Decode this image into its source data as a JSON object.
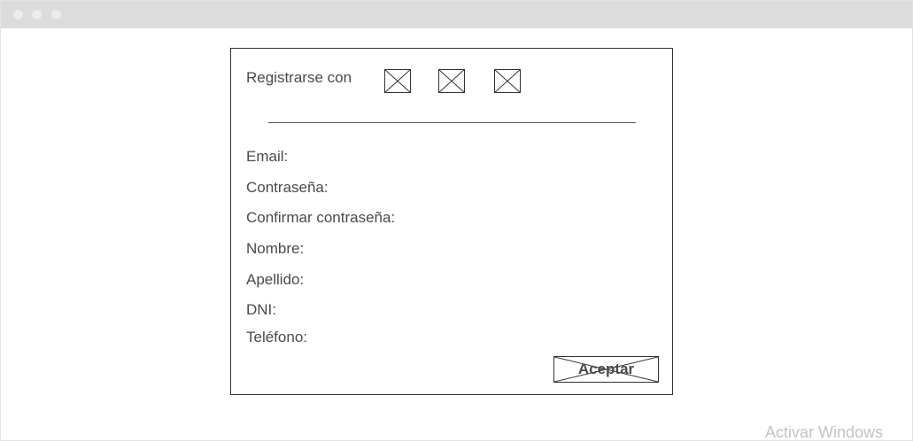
{
  "social_login": {
    "label": "Registrarse con",
    "buttons": [
      "image-placeholder",
      "image-placeholder",
      "image-placeholder"
    ]
  },
  "form": {
    "fields": [
      "Email:",
      "Contraseña:",
      "Confirmar contraseña:",
      "Nombre:",
      "Apellido:",
      "DNI:",
      "Teléfono:"
    ],
    "submit_label": "Aceptar"
  },
  "os_watermark": "Activar Windows",
  "colors": {
    "titlebar": "#dcdcdc",
    "border": "#333333",
    "text": "#4a4a4a",
    "watermark": "#c4c4c4"
  }
}
